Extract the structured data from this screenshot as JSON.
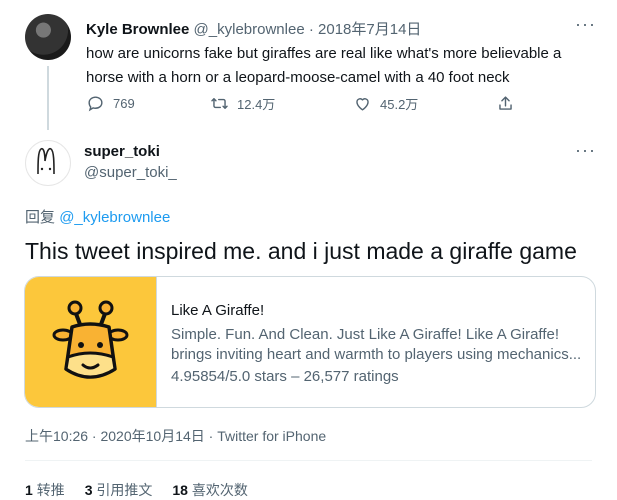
{
  "tweet1": {
    "name": "Kyle Brownlee",
    "handle": "@_kylebrownlee",
    "separator": "·",
    "date": "2018年7月14日",
    "more": "···",
    "text_line1": "how are unicorns fake but giraffes are real like what's more believable a",
    "text_line2": "horse with a horn or a leopard-moose-camel with a 40 foot neck",
    "replies": "769",
    "retweets": "12.4万",
    "likes": "45.2万"
  },
  "tweet2": {
    "name": "super_toki",
    "handle": "@super_toki_",
    "more": "···",
    "reply_prefix": "回复",
    "reply_to": "@_kylebrownlee",
    "text": "This tweet inspired me. and i just made a giraffe game"
  },
  "card": {
    "title": "Like A Giraffe!",
    "desc_line1": "Simple. Fun. And Clean. Just Like A Giraffe! Like A Giraffe!",
    "desc_line2": "brings inviting heart and warmth to players using mechanics...",
    "rating": "4.95854/5.0 stars – 26,577 ratings"
  },
  "meta": {
    "text": "上午10:26 · 2020年10月14日 · Twitter for iPhone"
  },
  "stats": {
    "retweets_count": "1",
    "retweets_label": "转推",
    "quotes_count": "3",
    "quotes_label": "引用推文",
    "likes_count": "18",
    "likes_label": "喜欢次数"
  },
  "colors": {
    "accent": "#1d9bf0",
    "muted": "#536471",
    "card_image_bg": "#fcc73b"
  }
}
